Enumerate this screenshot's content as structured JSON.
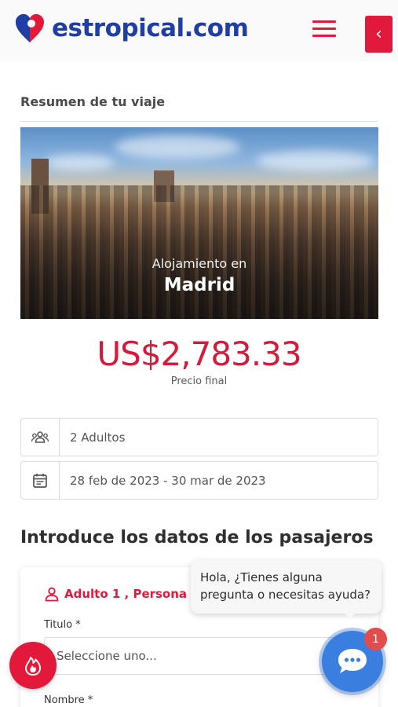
{
  "brand": {
    "name": "estropical.com",
    "color": "#1f3fa5",
    "accent": "#e3193b"
  },
  "header": {
    "menu_icon": "hamburger-icon",
    "back_icon": "chevron-left-icon",
    "back_glyph": "‹"
  },
  "summary": {
    "title": "Resumen de tu viaje",
    "hero_subtitle": "Alojamiento en",
    "hero_city": "Madrid",
    "price": "US$2,783.33",
    "price_label": "Precio final"
  },
  "details": {
    "travelers": {
      "icon": "group-icon",
      "value": "2 Adultos"
    },
    "dates": {
      "icon": "calendar-icon",
      "value": "28 feb de 2023 - 30 mar de 2023"
    }
  },
  "passengers": {
    "section_title": "Introduce los datos de los pasajeros",
    "adult_label": "Adulto 1 , Persona de",
    "title_field_label": "Titulo *",
    "title_placeholder": "Seleccione uno...",
    "name_field_label": "Nombre *"
  },
  "chat": {
    "message": "Hola, ¿Tienes alguna pregunta o necesitas ayuda?",
    "badge_count": "1",
    "icon": "chat-bubble-icon"
  },
  "promo": {
    "icon": "fire-icon"
  }
}
